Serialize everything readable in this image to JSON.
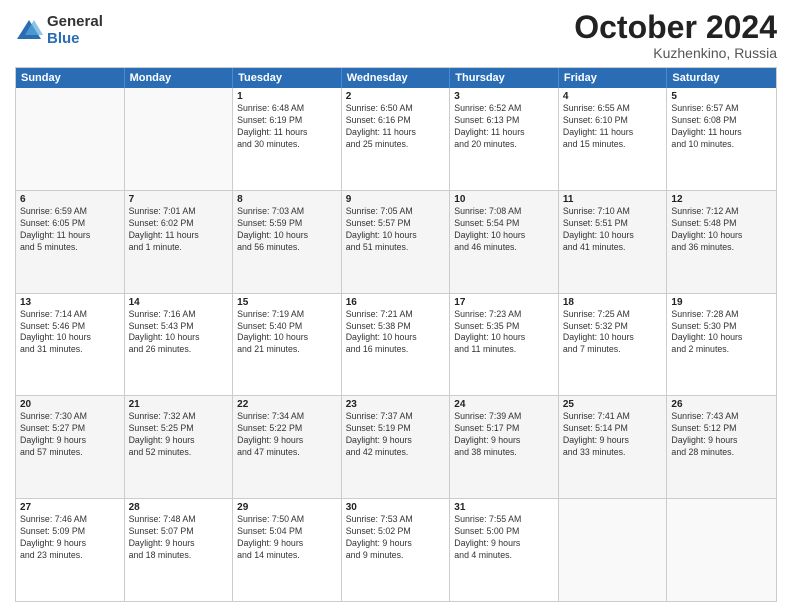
{
  "logo": {
    "general": "General",
    "blue": "Blue"
  },
  "title": "October 2024",
  "location": "Kuzhenkino, Russia",
  "days": [
    "Sunday",
    "Monday",
    "Tuesday",
    "Wednesday",
    "Thursday",
    "Friday",
    "Saturday"
  ],
  "weeks": [
    [
      {
        "day": "",
        "lines": []
      },
      {
        "day": "",
        "lines": []
      },
      {
        "day": "1",
        "lines": [
          "Sunrise: 6:48 AM",
          "Sunset: 6:19 PM",
          "Daylight: 11 hours",
          "and 30 minutes."
        ]
      },
      {
        "day": "2",
        "lines": [
          "Sunrise: 6:50 AM",
          "Sunset: 6:16 PM",
          "Daylight: 11 hours",
          "and 25 minutes."
        ]
      },
      {
        "day": "3",
        "lines": [
          "Sunrise: 6:52 AM",
          "Sunset: 6:13 PM",
          "Daylight: 11 hours",
          "and 20 minutes."
        ]
      },
      {
        "day": "4",
        "lines": [
          "Sunrise: 6:55 AM",
          "Sunset: 6:10 PM",
          "Daylight: 11 hours",
          "and 15 minutes."
        ]
      },
      {
        "day": "5",
        "lines": [
          "Sunrise: 6:57 AM",
          "Sunset: 6:08 PM",
          "Daylight: 11 hours",
          "and 10 minutes."
        ]
      }
    ],
    [
      {
        "day": "6",
        "lines": [
          "Sunrise: 6:59 AM",
          "Sunset: 6:05 PM",
          "Daylight: 11 hours",
          "and 5 minutes."
        ]
      },
      {
        "day": "7",
        "lines": [
          "Sunrise: 7:01 AM",
          "Sunset: 6:02 PM",
          "Daylight: 11 hours",
          "and 1 minute."
        ]
      },
      {
        "day": "8",
        "lines": [
          "Sunrise: 7:03 AM",
          "Sunset: 5:59 PM",
          "Daylight: 10 hours",
          "and 56 minutes."
        ]
      },
      {
        "day": "9",
        "lines": [
          "Sunrise: 7:05 AM",
          "Sunset: 5:57 PM",
          "Daylight: 10 hours",
          "and 51 minutes."
        ]
      },
      {
        "day": "10",
        "lines": [
          "Sunrise: 7:08 AM",
          "Sunset: 5:54 PM",
          "Daylight: 10 hours",
          "and 46 minutes."
        ]
      },
      {
        "day": "11",
        "lines": [
          "Sunrise: 7:10 AM",
          "Sunset: 5:51 PM",
          "Daylight: 10 hours",
          "and 41 minutes."
        ]
      },
      {
        "day": "12",
        "lines": [
          "Sunrise: 7:12 AM",
          "Sunset: 5:48 PM",
          "Daylight: 10 hours",
          "and 36 minutes."
        ]
      }
    ],
    [
      {
        "day": "13",
        "lines": [
          "Sunrise: 7:14 AM",
          "Sunset: 5:46 PM",
          "Daylight: 10 hours",
          "and 31 minutes."
        ]
      },
      {
        "day": "14",
        "lines": [
          "Sunrise: 7:16 AM",
          "Sunset: 5:43 PM",
          "Daylight: 10 hours",
          "and 26 minutes."
        ]
      },
      {
        "day": "15",
        "lines": [
          "Sunrise: 7:19 AM",
          "Sunset: 5:40 PM",
          "Daylight: 10 hours",
          "and 21 minutes."
        ]
      },
      {
        "day": "16",
        "lines": [
          "Sunrise: 7:21 AM",
          "Sunset: 5:38 PM",
          "Daylight: 10 hours",
          "and 16 minutes."
        ]
      },
      {
        "day": "17",
        "lines": [
          "Sunrise: 7:23 AM",
          "Sunset: 5:35 PM",
          "Daylight: 10 hours",
          "and 11 minutes."
        ]
      },
      {
        "day": "18",
        "lines": [
          "Sunrise: 7:25 AM",
          "Sunset: 5:32 PM",
          "Daylight: 10 hours",
          "and 7 minutes."
        ]
      },
      {
        "day": "19",
        "lines": [
          "Sunrise: 7:28 AM",
          "Sunset: 5:30 PM",
          "Daylight: 10 hours",
          "and 2 minutes."
        ]
      }
    ],
    [
      {
        "day": "20",
        "lines": [
          "Sunrise: 7:30 AM",
          "Sunset: 5:27 PM",
          "Daylight: 9 hours",
          "and 57 minutes."
        ]
      },
      {
        "day": "21",
        "lines": [
          "Sunrise: 7:32 AM",
          "Sunset: 5:25 PM",
          "Daylight: 9 hours",
          "and 52 minutes."
        ]
      },
      {
        "day": "22",
        "lines": [
          "Sunrise: 7:34 AM",
          "Sunset: 5:22 PM",
          "Daylight: 9 hours",
          "and 47 minutes."
        ]
      },
      {
        "day": "23",
        "lines": [
          "Sunrise: 7:37 AM",
          "Sunset: 5:19 PM",
          "Daylight: 9 hours",
          "and 42 minutes."
        ]
      },
      {
        "day": "24",
        "lines": [
          "Sunrise: 7:39 AM",
          "Sunset: 5:17 PM",
          "Daylight: 9 hours",
          "and 38 minutes."
        ]
      },
      {
        "day": "25",
        "lines": [
          "Sunrise: 7:41 AM",
          "Sunset: 5:14 PM",
          "Daylight: 9 hours",
          "and 33 minutes."
        ]
      },
      {
        "day": "26",
        "lines": [
          "Sunrise: 7:43 AM",
          "Sunset: 5:12 PM",
          "Daylight: 9 hours",
          "and 28 minutes."
        ]
      }
    ],
    [
      {
        "day": "27",
        "lines": [
          "Sunrise: 7:46 AM",
          "Sunset: 5:09 PM",
          "Daylight: 9 hours",
          "and 23 minutes."
        ]
      },
      {
        "day": "28",
        "lines": [
          "Sunrise: 7:48 AM",
          "Sunset: 5:07 PM",
          "Daylight: 9 hours",
          "and 18 minutes."
        ]
      },
      {
        "day": "29",
        "lines": [
          "Sunrise: 7:50 AM",
          "Sunset: 5:04 PM",
          "Daylight: 9 hours",
          "and 14 minutes."
        ]
      },
      {
        "day": "30",
        "lines": [
          "Sunrise: 7:53 AM",
          "Sunset: 5:02 PM",
          "Daylight: 9 hours",
          "and 9 minutes."
        ]
      },
      {
        "day": "31",
        "lines": [
          "Sunrise: 7:55 AM",
          "Sunset: 5:00 PM",
          "Daylight: 9 hours",
          "and 4 minutes."
        ]
      },
      {
        "day": "",
        "lines": []
      },
      {
        "day": "",
        "lines": []
      }
    ]
  ]
}
